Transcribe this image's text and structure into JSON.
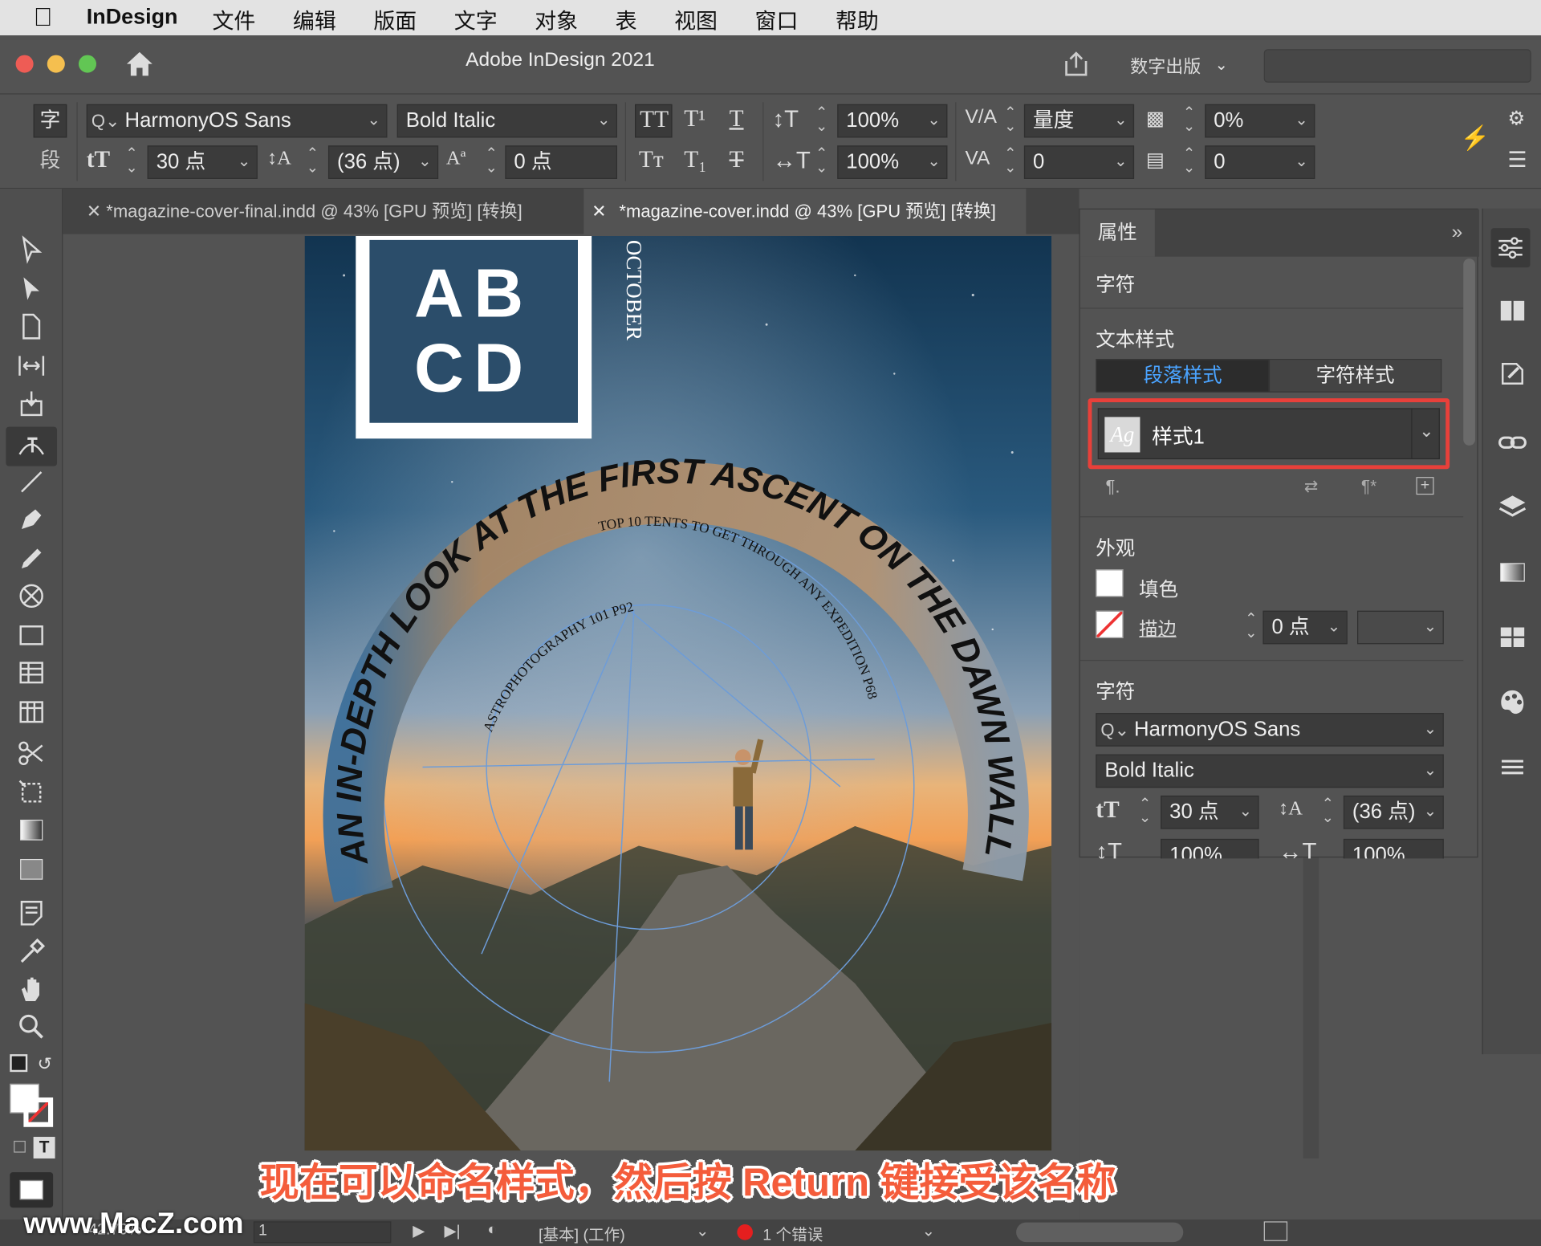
{
  "menubar": {
    "app_name": "InDesign",
    "menus": [
      "文件",
      "编辑",
      "版面",
      "文字",
      "对象",
      "表",
      "视图",
      "窗口",
      "帮助"
    ]
  },
  "titlebar": {
    "title": "Adobe InDesign 2021",
    "workspace": "数字出版"
  },
  "control": {
    "char_label": "字",
    "para_label": "段",
    "font_family": "HarmonyOS Sans",
    "font_style": "Bold Italic",
    "font_size": "30 点",
    "leading": "(36 点)",
    "baseline_shift": "0 点",
    "vertical_scale": "100%",
    "horizontal_scale": "100%",
    "kerning": "量度",
    "kerning_value": "0",
    "tracking": "0%",
    "skew": "0"
  },
  "tabs": [
    {
      "label": "*magazine-cover-final.indd @ 43% [GPU 预览] [转换]"
    },
    {
      "label": "*magazine-cover.indd @ 43% [GPU 预览] [转换]"
    }
  ],
  "cover": {
    "logo_line1": "AB",
    "logo_line2": "CD",
    "month": "OCTOBER",
    "arc_headline": "AN IN-DEPTH LOOK AT THE FIRST ASCENT ON THE DAWN WALL P38",
    "inner_arc_1": "TOP 10 TENTS TO GET THROUGH ANY EXPEDITION P68",
    "inner_arc_2": "ASTROPHOTOGRAPHY 101 P92"
  },
  "panel": {
    "tab": "属性",
    "section_char": "字符",
    "section_textstyle": "文本样式",
    "tab_para_style": "段落样式",
    "tab_char_style": "字符样式",
    "style_name": "样式1",
    "style_icon": "Ag",
    "section_appearance": "外观",
    "fill_label": "填色",
    "stroke_label": "描边",
    "stroke_weight": "0 点",
    "section_character": "字符",
    "font_family": "HarmonyOS Sans",
    "font_style": "Bold Italic",
    "font_size": "30 点",
    "leading": "(36 点)",
    "scale_v": "100%",
    "scale_h": "100%"
  },
  "status": {
    "zoom": "42.79%",
    "page": "1",
    "profile": "[基本] (工作)",
    "errors": "1 个错误"
  },
  "caption": "现在可以命名样式，然后按 Return 键接受该名称",
  "watermark": "www.MacZ.com",
  "colors": {
    "highlight": "#e8403a",
    "active_tab_text": "#4aa3ff",
    "caption": "#f45c3b"
  }
}
